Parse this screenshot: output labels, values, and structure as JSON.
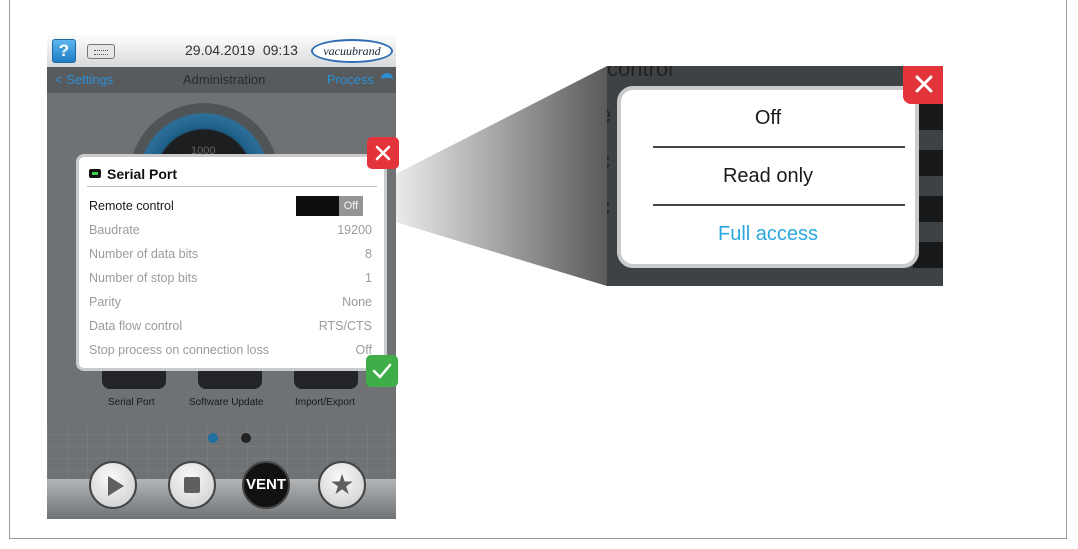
{
  "device": {
    "help_label": "?",
    "date": "29.04.2019",
    "time": "09:13",
    "logo_text": "vacuubrand",
    "nav": {
      "back": "< Settings",
      "title": "Administration",
      "process": "Process"
    },
    "gauge_value": "1000",
    "tiles": [
      {
        "label": "Serial Port"
      },
      {
        "label": "Software Update"
      },
      {
        "label": "Import/Export"
      }
    ],
    "page_dots": {
      "count": 2,
      "active": 0
    },
    "controls": {
      "vent_label": "VENT"
    }
  },
  "dialog": {
    "title": "Serial Port",
    "rows": [
      {
        "label": "Remote control",
        "value": "Off",
        "type": "toggle"
      },
      {
        "label": "Baudrate",
        "value": "19200"
      },
      {
        "label": "Number of data bits",
        "value": "8"
      },
      {
        "label": "Number of stop bits",
        "value": "1"
      },
      {
        "label": "Parity",
        "value": "None"
      },
      {
        "label": "Data flow control",
        "value": "RTS/CTS"
      },
      {
        "label": "Stop process on connection loss",
        "value": "Off"
      }
    ]
  },
  "zoom": {
    "background_label": "control",
    "background_letters": [
      "e",
      "c",
      "c"
    ],
    "options": [
      {
        "label": "Off"
      },
      {
        "label": "Read only"
      },
      {
        "label": "Full access",
        "selected": true
      }
    ]
  },
  "colors": {
    "accent": "#2b8fd6",
    "selected_option": "#2aa7de",
    "close": "#e2343a",
    "confirm": "#3fae48",
    "toggle_knob": "#959596"
  }
}
